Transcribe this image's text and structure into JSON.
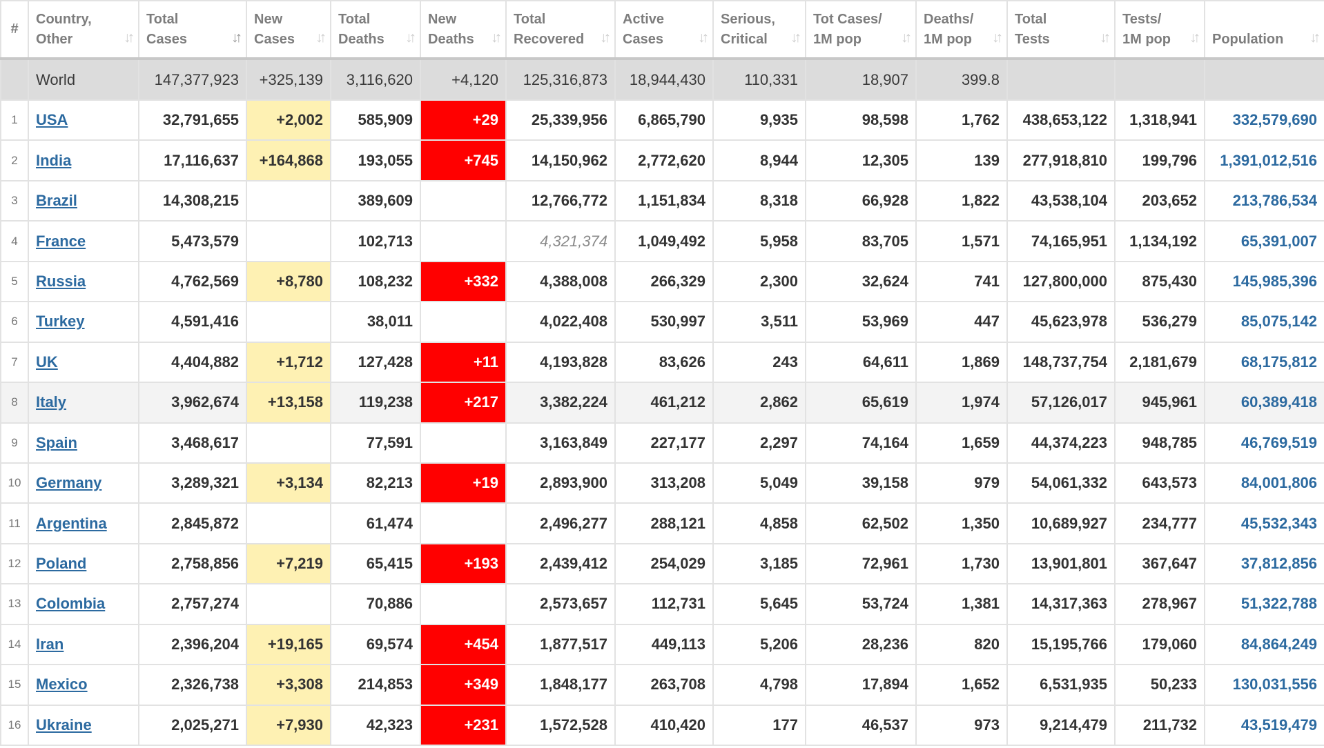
{
  "columns": [
    {
      "line1": "#",
      "line2": "",
      "sort_icon": ""
    },
    {
      "line1": "Country,",
      "line2": "Other",
      "sort_icon": "sort-icon"
    },
    {
      "line1": "Total",
      "line2": "Cases",
      "sort_icon": "sort-desc-icon"
    },
    {
      "line1": "New",
      "line2": "Cases",
      "sort_icon": "sort-icon"
    },
    {
      "line1": "Total",
      "line2": "Deaths",
      "sort_icon": "sort-icon"
    },
    {
      "line1": "New",
      "line2": "Deaths",
      "sort_icon": "sort-icon"
    },
    {
      "line1": "Total",
      "line2": "Recovered",
      "sort_icon": "sort-icon"
    },
    {
      "line1": "Active",
      "line2": "Cases",
      "sort_icon": "sort-icon"
    },
    {
      "line1": "Serious,",
      "line2": "Critical",
      "sort_icon": "sort-icon"
    },
    {
      "line1": "Tot Cases/",
      "line2": "1M pop",
      "sort_icon": "sort-icon"
    },
    {
      "line1": "Deaths/",
      "line2": "1M pop",
      "sort_icon": "sort-icon"
    },
    {
      "line1": "Total",
      "line2": "Tests",
      "sort_icon": "sort-icon"
    },
    {
      "line1": "Tests/",
      "line2": "1M pop",
      "sort_icon": "sort-icon"
    },
    {
      "line1": "",
      "line2": "Population",
      "sort_icon": "sort-icon"
    }
  ],
  "world": {
    "label": "World",
    "total_cases": "147,377,923",
    "new_cases": "+325,139",
    "total_deaths": "3,116,620",
    "new_deaths": "+4,120",
    "total_recovered": "125,316,873",
    "active_cases": "18,944,430",
    "serious_critical": "110,331",
    "cases_per_1m": "18,907",
    "deaths_per_1m": "399.8",
    "total_tests": "",
    "tests_per_1m": "",
    "population": ""
  },
  "rows": [
    {
      "idx": "1",
      "country": "USA",
      "total_cases": "32,791,655",
      "new_cases": "+2,002",
      "total_deaths": "585,909",
      "new_deaths": "+29",
      "total_recovered": "25,339,956",
      "active_cases": "6,865,790",
      "serious_critical": "9,935",
      "cases_per_1m": "98,598",
      "deaths_per_1m": "1,762",
      "total_tests": "438,653,122",
      "tests_per_1m": "1,318,941",
      "population": "332,579,690"
    },
    {
      "idx": "2",
      "country": "India",
      "total_cases": "17,116,637",
      "new_cases": "+164,868",
      "total_deaths": "193,055",
      "new_deaths": "+745",
      "total_recovered": "14,150,962",
      "active_cases": "2,772,620",
      "serious_critical": "8,944",
      "cases_per_1m": "12,305",
      "deaths_per_1m": "139",
      "total_tests": "277,918,810",
      "tests_per_1m": "199,796",
      "population": "1,391,012,516"
    },
    {
      "idx": "3",
      "country": "Brazil",
      "total_cases": "14,308,215",
      "new_cases": "",
      "total_deaths": "389,609",
      "new_deaths": "",
      "total_recovered": "12,766,772",
      "active_cases": "1,151,834",
      "serious_critical": "8,318",
      "cases_per_1m": "66,928",
      "deaths_per_1m": "1,822",
      "total_tests": "43,538,104",
      "tests_per_1m": "203,652",
      "population": "213,786,534"
    },
    {
      "idx": "4",
      "country": "France",
      "total_cases": "5,473,579",
      "new_cases": "",
      "total_deaths": "102,713",
      "new_deaths": "",
      "total_recovered": "4,321,374",
      "active_cases": "1,049,492",
      "serious_critical": "5,958",
      "cases_per_1m": "83,705",
      "deaths_per_1m": "1,571",
      "total_tests": "74,165,951",
      "tests_per_1m": "1,134,192",
      "population": "65,391,007"
    },
    {
      "idx": "5",
      "country": "Russia",
      "total_cases": "4,762,569",
      "new_cases": "+8,780",
      "total_deaths": "108,232",
      "new_deaths": "+332",
      "total_recovered": "4,388,008",
      "active_cases": "266,329",
      "serious_critical": "2,300",
      "cases_per_1m": "32,624",
      "deaths_per_1m": "741",
      "total_tests": "127,800,000",
      "tests_per_1m": "875,430",
      "population": "145,985,396"
    },
    {
      "idx": "6",
      "country": "Turkey",
      "total_cases": "4,591,416",
      "new_cases": "",
      "total_deaths": "38,011",
      "new_deaths": "",
      "total_recovered": "4,022,408",
      "active_cases": "530,997",
      "serious_critical": "3,511",
      "cases_per_1m": "53,969",
      "deaths_per_1m": "447",
      "total_tests": "45,623,978",
      "tests_per_1m": "536,279",
      "population": "85,075,142"
    },
    {
      "idx": "7",
      "country": "UK",
      "total_cases": "4,404,882",
      "new_cases": "+1,712",
      "total_deaths": "127,428",
      "new_deaths": "+11",
      "total_recovered": "4,193,828",
      "active_cases": "83,626",
      "serious_critical": "243",
      "cases_per_1m": "64,611",
      "deaths_per_1m": "1,869",
      "total_tests": "148,737,754",
      "tests_per_1m": "2,181,679",
      "population": "68,175,812"
    },
    {
      "idx": "8",
      "country": "Italy",
      "total_cases": "3,962,674",
      "new_cases": "+13,158",
      "total_deaths": "119,238",
      "new_deaths": "+217",
      "total_recovered": "3,382,224",
      "active_cases": "461,212",
      "serious_critical": "2,862",
      "cases_per_1m": "65,619",
      "deaths_per_1m": "1,974",
      "total_tests": "57,126,017",
      "tests_per_1m": "945,961",
      "population": "60,389,418"
    },
    {
      "idx": "9",
      "country": "Spain",
      "total_cases": "3,468,617",
      "new_cases": "",
      "total_deaths": "77,591",
      "new_deaths": "",
      "total_recovered": "3,163,849",
      "active_cases": "227,177",
      "serious_critical": "2,297",
      "cases_per_1m": "74,164",
      "deaths_per_1m": "1,659",
      "total_tests": "44,374,223",
      "tests_per_1m": "948,785",
      "population": "46,769,519"
    },
    {
      "idx": "10",
      "country": "Germany",
      "total_cases": "3,289,321",
      "new_cases": "+3,134",
      "total_deaths": "82,213",
      "new_deaths": "+19",
      "total_recovered": "2,893,900",
      "active_cases": "313,208",
      "serious_critical": "5,049",
      "cases_per_1m": "39,158",
      "deaths_per_1m": "979",
      "total_tests": "54,061,332",
      "tests_per_1m": "643,573",
      "population": "84,001,806"
    },
    {
      "idx": "11",
      "country": "Argentina",
      "total_cases": "2,845,872",
      "new_cases": "",
      "total_deaths": "61,474",
      "new_deaths": "",
      "total_recovered": "2,496,277",
      "active_cases": "288,121",
      "serious_critical": "4,858",
      "cases_per_1m": "62,502",
      "deaths_per_1m": "1,350",
      "total_tests": "10,689,927",
      "tests_per_1m": "234,777",
      "population": "45,532,343"
    },
    {
      "idx": "12",
      "country": "Poland",
      "total_cases": "2,758,856",
      "new_cases": "+7,219",
      "total_deaths": "65,415",
      "new_deaths": "+193",
      "total_recovered": "2,439,412",
      "active_cases": "254,029",
      "serious_critical": "3,185",
      "cases_per_1m": "72,961",
      "deaths_per_1m": "1,730",
      "total_tests": "13,901,801",
      "tests_per_1m": "367,647",
      "population": "37,812,856"
    },
    {
      "idx": "13",
      "country": "Colombia",
      "total_cases": "2,757,274",
      "new_cases": "",
      "total_deaths": "70,886",
      "new_deaths": "",
      "total_recovered": "2,573,657",
      "active_cases": "112,731",
      "serious_critical": "5,645",
      "cases_per_1m": "53,724",
      "deaths_per_1m": "1,381",
      "total_tests": "14,317,363",
      "tests_per_1m": "278,967",
      "population": "51,322,788"
    },
    {
      "idx": "14",
      "country": "Iran",
      "total_cases": "2,396,204",
      "new_cases": "+19,165",
      "total_deaths": "69,574",
      "new_deaths": "+454",
      "total_recovered": "1,877,517",
      "active_cases": "449,113",
      "serious_critical": "5,206",
      "cases_per_1m": "28,236",
      "deaths_per_1m": "820",
      "total_tests": "15,195,766",
      "tests_per_1m": "179,060",
      "population": "84,864,249"
    },
    {
      "idx": "15",
      "country": "Mexico",
      "total_cases": "2,326,738",
      "new_cases": "+3,308",
      "total_deaths": "214,853",
      "new_deaths": "+349",
      "total_recovered": "1,848,177",
      "active_cases": "263,708",
      "serious_critical": "4,798",
      "cases_per_1m": "17,894",
      "deaths_per_1m": "1,652",
      "total_tests": "6,531,935",
      "tests_per_1m": "50,233",
      "population": "130,031,556"
    },
    {
      "idx": "16",
      "country": "Ukraine",
      "total_cases": "2,025,271",
      "new_cases": "+7,930",
      "total_deaths": "42,323",
      "new_deaths": "+231",
      "total_recovered": "1,572,528",
      "active_cases": "410,420",
      "serious_critical": "177",
      "cases_per_1m": "46,537",
      "deaths_per_1m": "973",
      "total_tests": "9,214,479",
      "tests_per_1m": "211,732",
      "population": "43,519,479"
    }
  ],
  "colors": {
    "new_cases_highlight": "#fef1b3",
    "new_deaths_highlight": "#ff0000",
    "link": "#2c6aa0",
    "world_row": "#dcdcdc"
  }
}
